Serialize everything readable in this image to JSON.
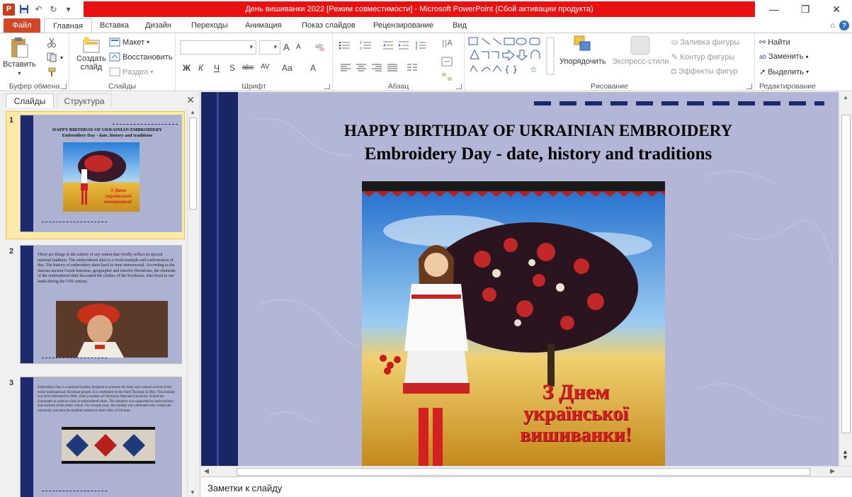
{
  "window": {
    "title": "День вишиванки 2022 [Режим совместимости] - Microsoft PowerPoint (Сбой активации продукта)",
    "minimize": "—",
    "restore": "❐",
    "close": "✕"
  },
  "qat": {
    "logo": "P",
    "save": "💾",
    "undo": "↶",
    "redo": "↻",
    "customize": "▾"
  },
  "tabs": [
    "Файл",
    "Главная",
    "Вставка",
    "Дизайн",
    "Переходы",
    "Анимация",
    "Показ слайдов",
    "Рецензирование",
    "Вид"
  ],
  "help": {
    "collapse": "⌂",
    "icon": "?"
  },
  "ribbon": {
    "clipboard": {
      "paste": "Вставить",
      "label": "Буфер обмена"
    },
    "slides": {
      "new_slide_line1": "Создать",
      "new_slide_line2": "слайд",
      "layout": "Макет",
      "reset": "Восстановить",
      "section": "Раздел",
      "label": "Слайды"
    },
    "font": {
      "bold": "Ж",
      "italic": "К",
      "underline": "Ч",
      "strike": "S",
      "strike2": "abc",
      "spacing": "AV",
      "case": "Aa",
      "color": "A",
      "grow": "A",
      "shrink": "A",
      "label": "Шрифт"
    },
    "paragraph": {
      "label": "Абзац"
    },
    "drawing": {
      "arrange": "Упорядочить",
      "quick_styles": "Экспресс-стили",
      "fill": "Заливка фигуры",
      "outline": "Контур фигуры",
      "effects": "Эффекты фигур",
      "label": "Рисование"
    },
    "editing": {
      "find": "Найти",
      "replace": "Заменить",
      "select": "Выделить",
      "label": "Редактирование"
    }
  },
  "left_panel": {
    "tab_slides": "Слайды",
    "tab_structure": "Структура",
    "close": "✕",
    "thumbs": [
      {
        "num": "1",
        "title1": "HAPPY BIRTHDAY OF UKRAINIAN EMBROIDERY",
        "title2": "Embroidery Day - date, history and traditions",
        "caption": "З Днем української вишиванки!"
      },
      {
        "num": "2",
        "text": "There are things in the culture of any nation that vividly reflect its special national tradition. The embroidered shirt is a vivid example and confirmation of this. The history of embroidery dates back to time immemorial. According to the famous ancient Greek historian, geographer and traveler Herodotus, the elements of the embroidered shirt decorated the clothes of the Scythians, who lived in our lands during the VIII century."
      },
      {
        "num": "3",
        "text": "Embroidery Day is a national holiday designed to promote the unity and cultural revival of the entire multinational Ukrainian people. It is celebrated on the third Thursday in May. This holiday was first celebrated in 2006, when a student of Chernivtsi National University invited her classmates to come to class in embroidered shirts. The initiative was supported by both teachers and students of the entire school. For several years, the holiday was celebrated only within the university, and then the tradition spread to other cities of Ukraine."
      }
    ]
  },
  "slide": {
    "title1": "HAPPY BIRTHDAY OF UKRAINIAN EMBROIDERY",
    "title2": "Embroidery Day - date, history and traditions",
    "caption_line1": "З Днем",
    "caption_line2": "української",
    "caption_line3": "вишиванки!"
  },
  "notes": {
    "placeholder": "Заметки к слайду"
  },
  "colors": {
    "title_bar_red": "#e81010",
    "file_tab": "#d24726",
    "slide_bg": "#b3b6d6",
    "slide_bar": "#1a2566",
    "caption": "#d81e1e"
  }
}
